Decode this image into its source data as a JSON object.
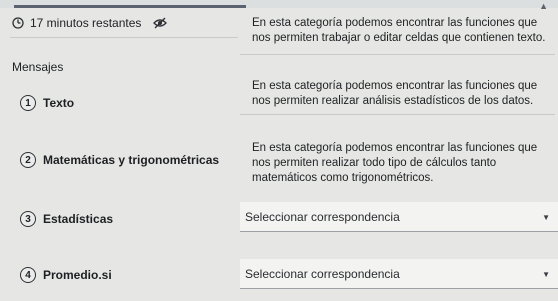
{
  "timer": {
    "text": "17 minutos restantes"
  },
  "section": {
    "title": "Mensajes"
  },
  "items": [
    {
      "num": "1",
      "label": "Texto"
    },
    {
      "num": "2",
      "label": "Matemáticas y trigonométricas"
    },
    {
      "num": "3",
      "label": "Estadísticas"
    },
    {
      "num": "4",
      "label": "Promedio.si"
    }
  ],
  "descriptions": [
    "En esta categoría podemos encontrar las funciones que nos permiten trabajar o editar celdas que contienen texto.",
    "En esta categoría podemos encontrar las funciones que nos permiten realizar análisis estadísticos de los datos.",
    "En esta categoría podemos encontrar las funciones que nos permiten realizar todo tipo de cálculos tanto matemáticos como trigonométricos."
  ],
  "selects": [
    {
      "value": "Seleccionar correspondencia"
    },
    {
      "value": "Seleccionar correspondencia"
    }
  ],
  "colors": {
    "accent_bar": "#5c6370",
    "background": "#e6e7e5"
  }
}
